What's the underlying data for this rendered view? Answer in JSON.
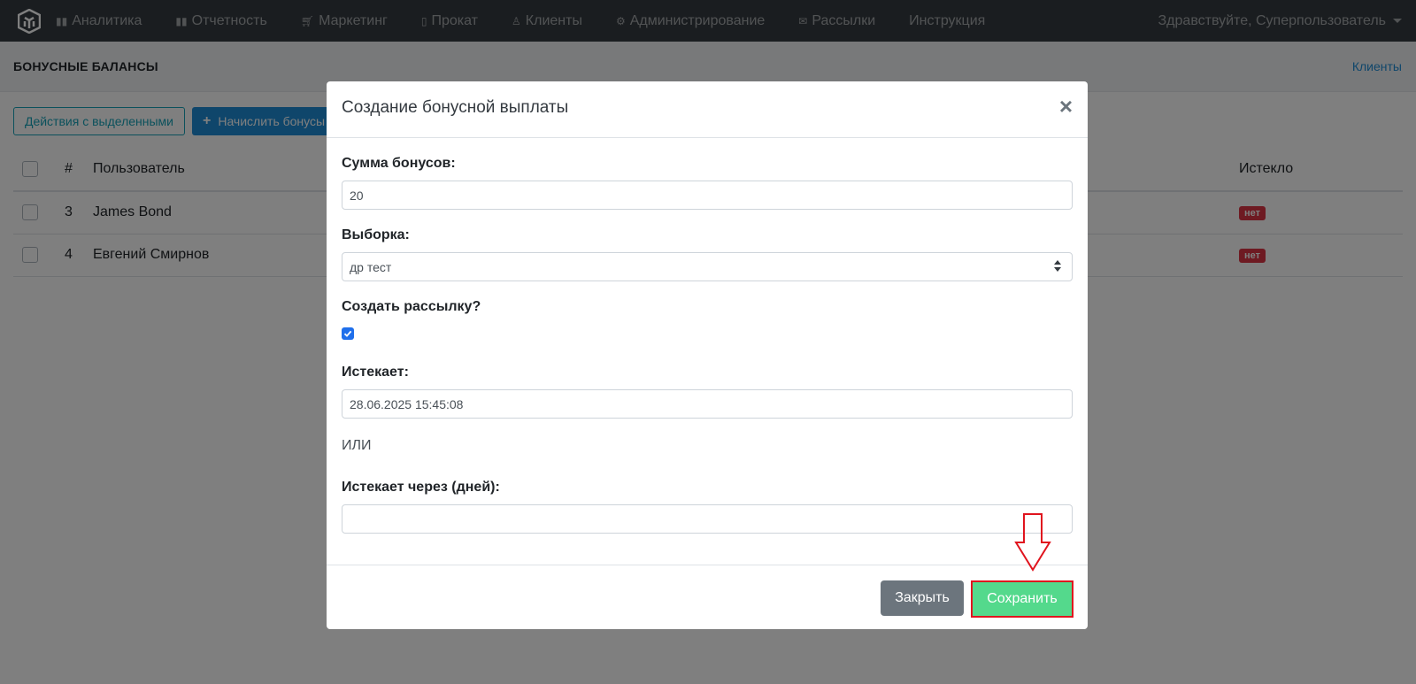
{
  "nav": {
    "items": [
      {
        "label": "Аналитика",
        "icon": "bar-chart-icon"
      },
      {
        "label": "Отчетность",
        "icon": "bar-chart-icon"
      },
      {
        "label": "Маркетинг",
        "icon": "cart-icon"
      },
      {
        "label": "Прокат",
        "icon": "book-icon"
      },
      {
        "label": "Клиенты",
        "icon": "user-icon"
      },
      {
        "label": "Администрирование",
        "icon": "gears-icon"
      },
      {
        "label": "Рассылки",
        "icon": "envelope-icon"
      },
      {
        "label": "Инструкция",
        "icon": ""
      }
    ],
    "user": "Здравствуйте, Суперпользователь"
  },
  "page": {
    "title": "БОНУСНЫЕ БАЛАНСЫ",
    "link": "Клиенты",
    "actions_label": "Действия с выделенными",
    "add_label": "Начислить бонусы"
  },
  "table": {
    "headers": {
      "num": "#",
      "user": "Пользователь",
      "expired": "Истекло"
    },
    "rows": [
      {
        "num": "3",
        "user": "James Bond",
        "expired": "нет"
      },
      {
        "num": "4",
        "user": "Евгений Смирнов",
        "expired": "нет"
      }
    ]
  },
  "modal": {
    "title": "Создание бонусной выплаты",
    "close_symbol": "×",
    "amount_label": "Сумма бонусов:",
    "amount_value": "20",
    "selection_label": "Выборка:",
    "selection_value": "др тест",
    "mailing_label": "Создать рассылку?",
    "mailing_checked": true,
    "expires_label": "Истекает:",
    "expires_value": "28.06.2025 15:45:08",
    "or_text": "ИЛИ",
    "expires_days_label": "Истекает через (дней):",
    "expires_days_value": "",
    "close_button": "Закрыть",
    "save_button": "Сохранить"
  },
  "colors": {
    "navbar": "#343a40",
    "primary": "#1f8dd6",
    "info": "#17a2b8",
    "danger": "#dc3545",
    "save": "#54d98c",
    "highlight": "#e0141e"
  }
}
